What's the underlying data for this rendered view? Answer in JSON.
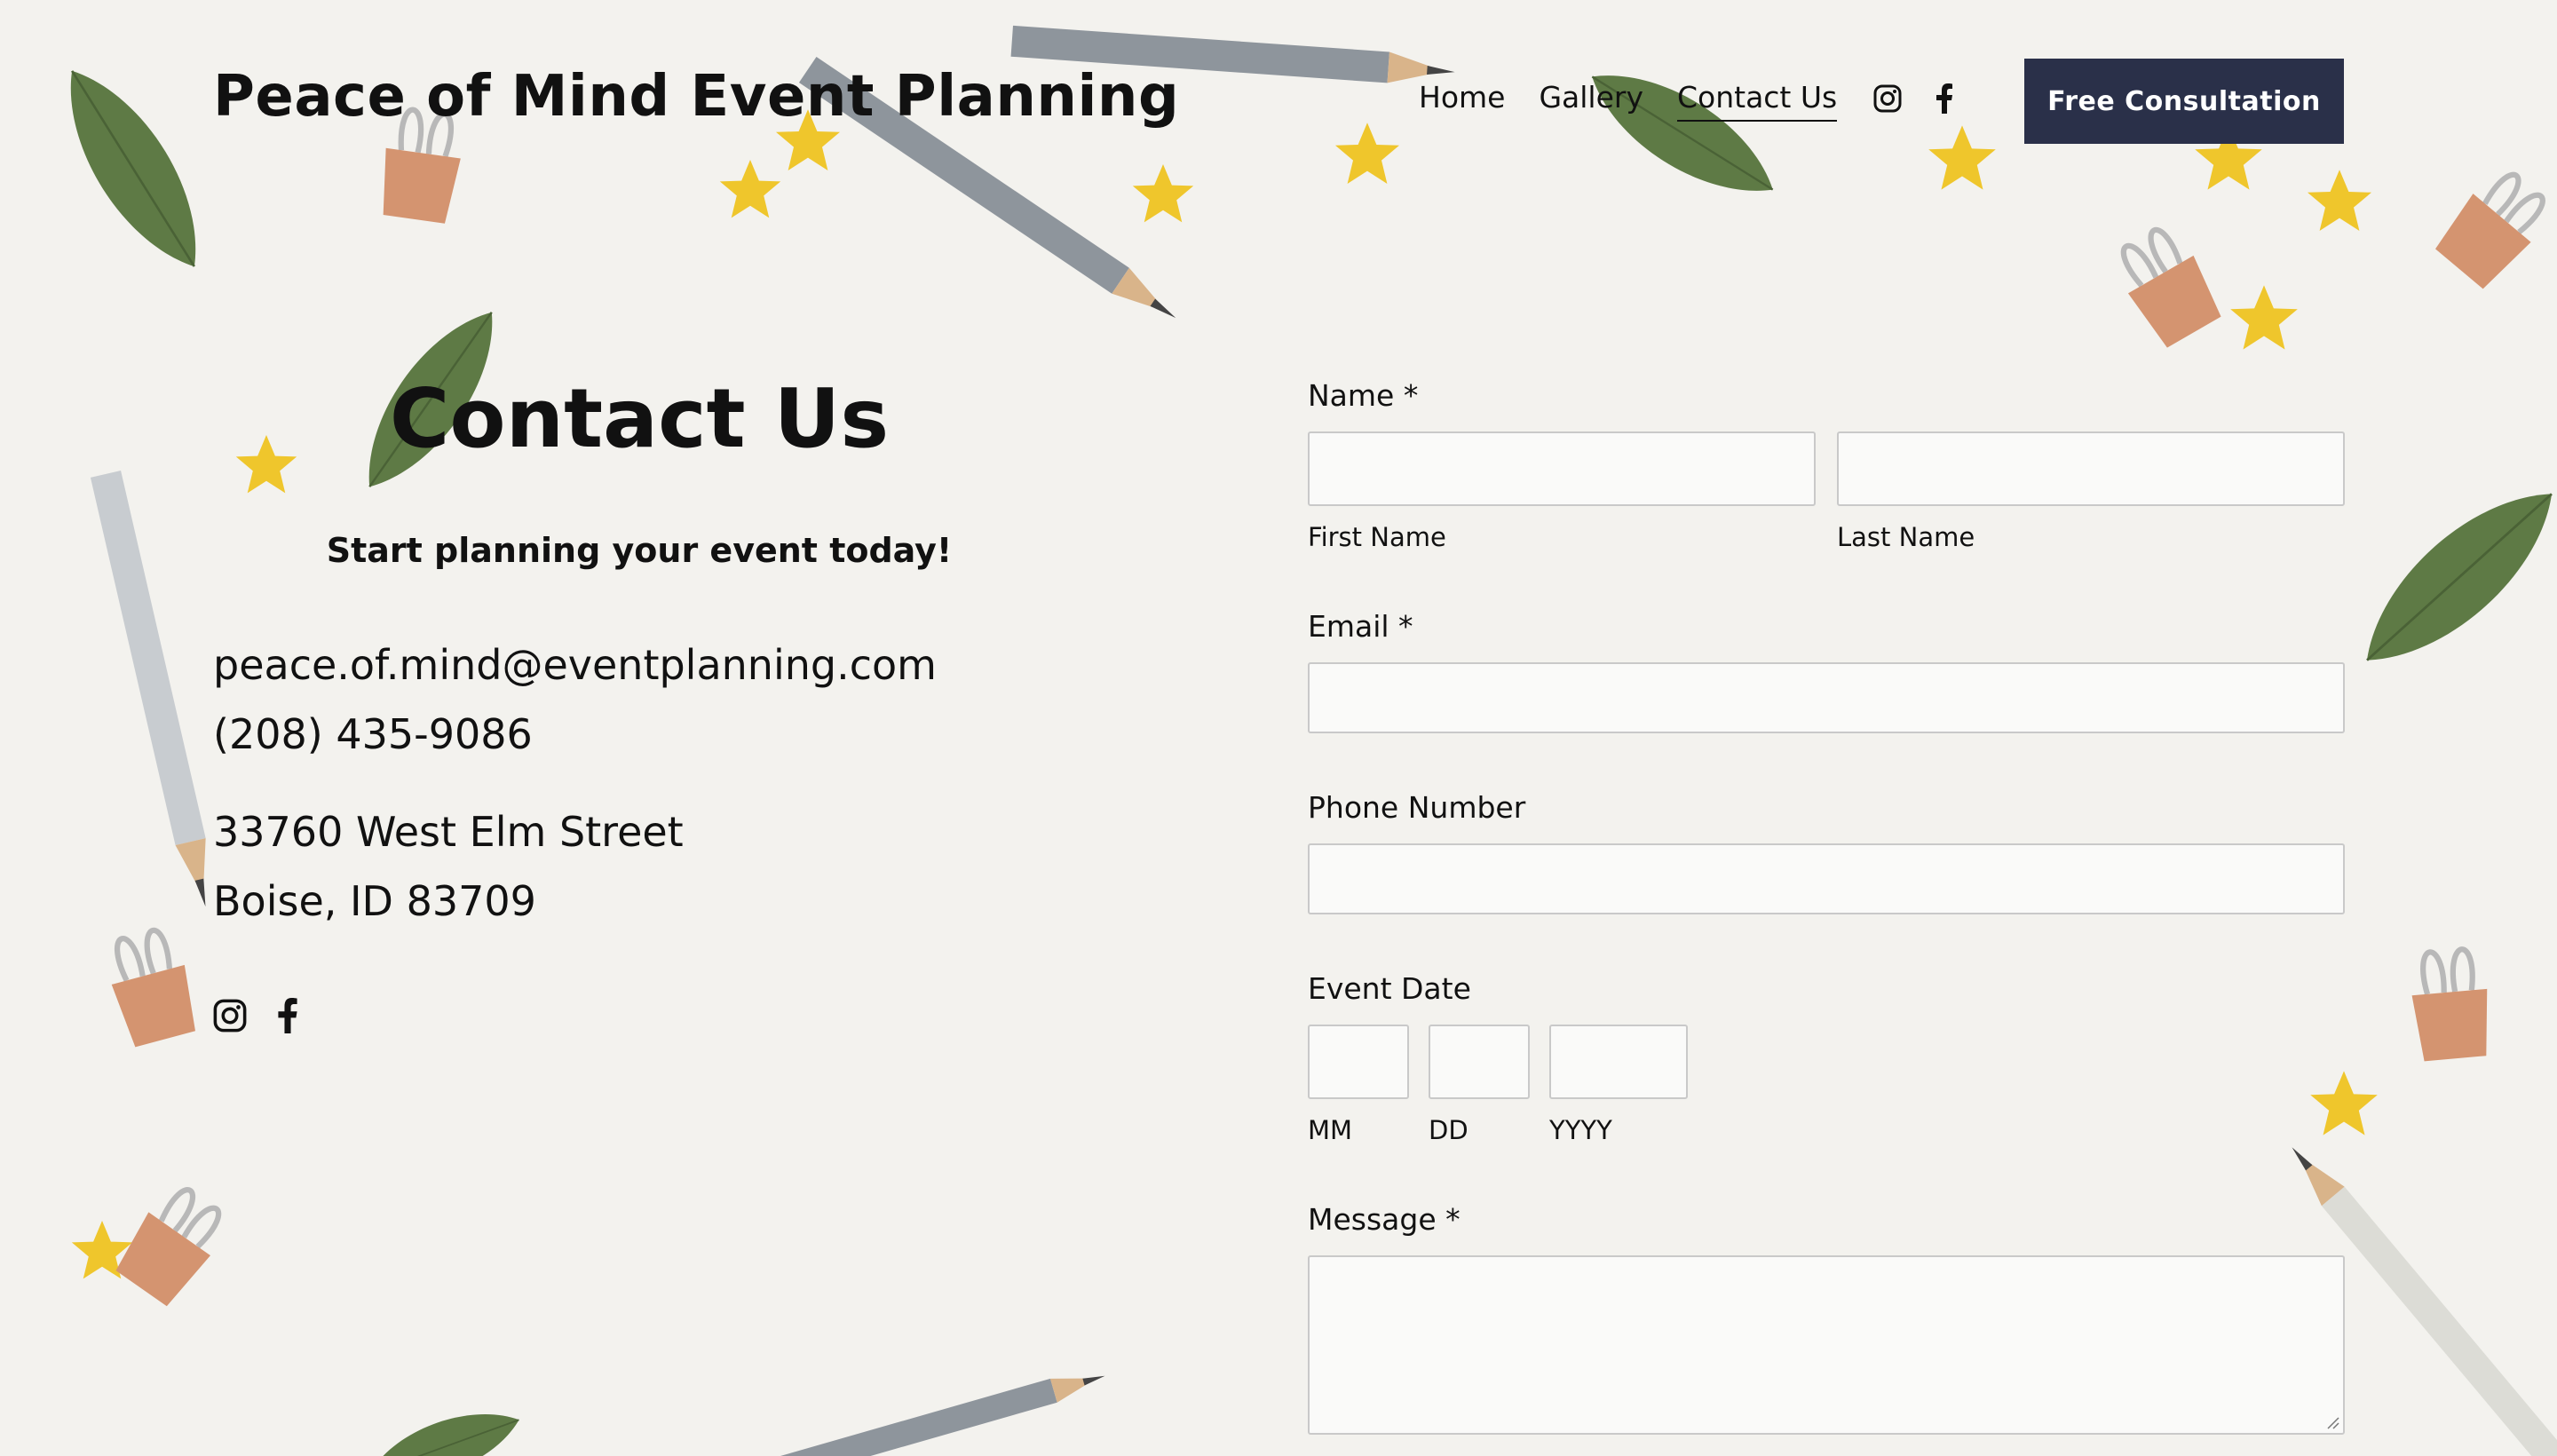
{
  "header": {
    "site_title": "Peace of Mind Event Planning",
    "nav": [
      "Home",
      "Gallery",
      "Contact Us"
    ],
    "active_nav": "Contact Us",
    "social_icons": [
      "instagram-icon",
      "facebook-icon"
    ],
    "cta_label": "Free Consultation"
  },
  "left": {
    "heading": "Contact Us",
    "subheading": "Start planning your event today!",
    "email": "peace.of.mind@eventplanning.com",
    "phone": "(208) 435-9086",
    "address_line1": "33760 West Elm Street",
    "address_line2": "Boise, ID 83709",
    "social_icons": [
      "instagram-icon",
      "facebook-icon"
    ]
  },
  "form": {
    "name_label": "Name *",
    "first_name_label": "First Name",
    "last_name_label": "Last Name",
    "email_label": "Email *",
    "phone_label": "Phone Number",
    "event_date_label": "Event Date",
    "mm_label": "MM",
    "dd_label": "DD",
    "yyyy_label": "YYYY",
    "message_label": "Message *",
    "values": {
      "first_name": "",
      "last_name": "",
      "email": "",
      "phone": "",
      "mm": "",
      "dd": "",
      "yyyy": "",
      "message": ""
    }
  },
  "colors": {
    "background": "#f3f2ee",
    "cta_background": "#2a3049",
    "cta_text": "#ffffff",
    "text": "#111111",
    "field_border": "#c9c9c9",
    "leaf": "#5e7a45",
    "pencil": "#8e959c",
    "star": "#efc62c",
    "clip": "#d49470"
  }
}
